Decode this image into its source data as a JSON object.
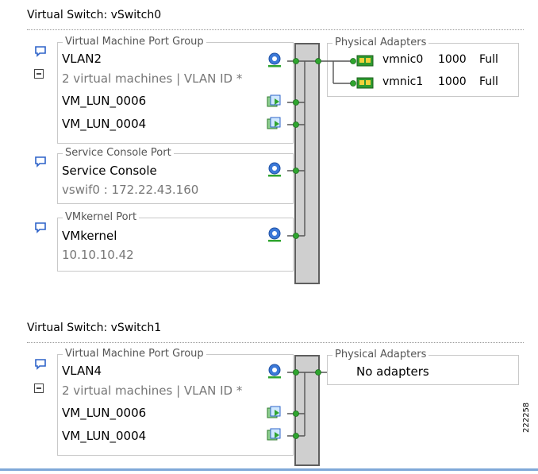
{
  "switches": [
    {
      "title": "Virtual Switch: vSwitch0",
      "port_groups": [
        {
          "legend": "Virtual Machine Port Group",
          "name": "VLAN2",
          "detail": "2 virtual machines | VLAN ID *",
          "vms": [
            "VM_LUN_0006",
            "VM_LUN_0004"
          ]
        },
        {
          "legend": "Service Console Port",
          "name": "Service Console",
          "detail": "vswif0 : 172.22.43.160"
        },
        {
          "legend": "VMkernel Port",
          "name": "VMkernel",
          "detail": "10.10.10.42"
        }
      ],
      "adapters_legend": "Physical Adapters",
      "adapters": [
        {
          "name": "vmnic0",
          "speed": "1000",
          "duplex": "Full"
        },
        {
          "name": "vmnic1",
          "speed": "1000",
          "duplex": "Full"
        }
      ]
    },
    {
      "title": "Virtual Switch: vSwitch1",
      "port_groups": [
        {
          "legend": "Virtual Machine Port Group",
          "name": "VLAN4",
          "detail": "2 virtual machines | VLAN ID *",
          "vms": [
            "VM_LUN_0006",
            "VM_LUN_0004"
          ]
        }
      ],
      "adapters_legend": "Physical Adapters",
      "no_adapters": "No adapters"
    }
  ],
  "figure_code": "222258",
  "icons": {
    "comment": "comment-icon",
    "collapse": "collapse-icon",
    "network": "network-globe-icon",
    "vm": "vm-icon",
    "nic": "nic-card-icon"
  },
  "colors": {
    "bar_fill": "#cfcfcf",
    "bar_border": "#5e5e5e",
    "link_line": "#555555",
    "port_dot": "#2fa52f",
    "accent_blue": "#2e63c9",
    "bottom_line": "#7fa8d8"
  }
}
